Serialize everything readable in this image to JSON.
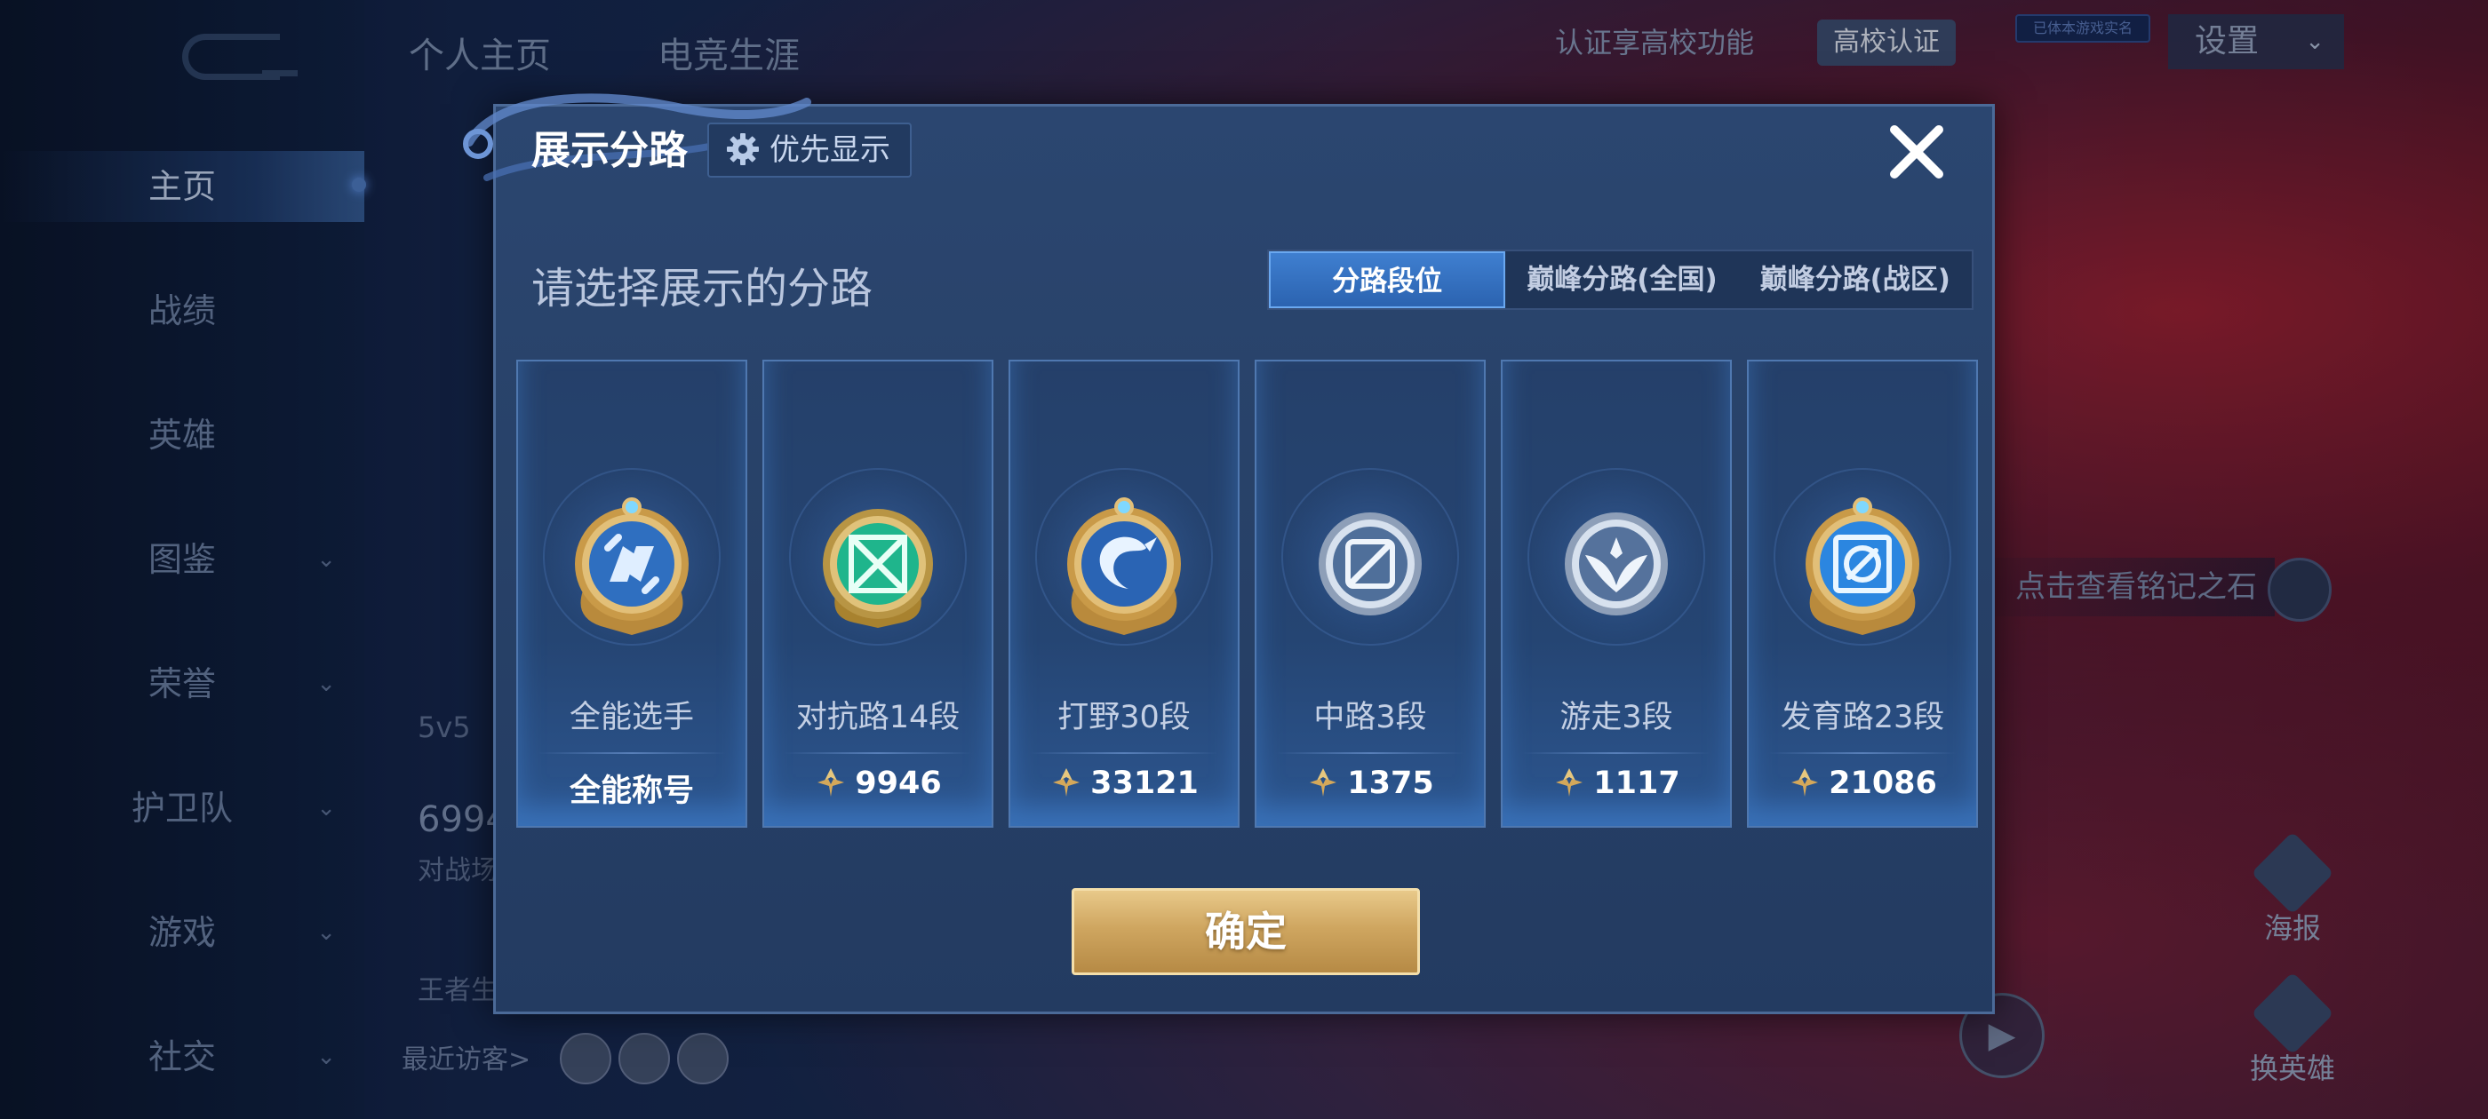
{
  "background": {
    "sidebar": {
      "items": [
        {
          "label": "主页",
          "active": true
        },
        {
          "label": "战绩"
        },
        {
          "label": "英雄"
        },
        {
          "label": "图鉴",
          "expandable": true
        },
        {
          "label": "荣誉",
          "expandable": true
        },
        {
          "label": "护卫队",
          "expandable": true
        },
        {
          "label": "游戏",
          "expandable": true
        },
        {
          "label": "社交",
          "expandable": true
        }
      ]
    },
    "top_tabs": [
      "个人主页",
      "电竞生涯"
    ],
    "cert_text": "认证享高校功能",
    "cert_badge": "高校认证",
    "tiny_tag": "已体本游戏实名",
    "settings": "设置",
    "stone_tip": "点击查看铭记之石",
    "poster": "海报",
    "swap_hero": "换英雄",
    "recent_visitors": "最近访客>",
    "partial": {
      "mode": "5v5",
      "count": "6994",
      "battle": "对战场",
      "king": "王者生"
    }
  },
  "modal": {
    "title": "展示分路",
    "priority_button": "优先显示",
    "subtitle": "请选择展示的分路",
    "tabs": [
      {
        "label": "分路段位",
        "active": true
      },
      {
        "label": "巅峰分路(全国)",
        "active": false
      },
      {
        "label": "巅峰分路(战区)",
        "active": false
      }
    ],
    "cards": [
      {
        "name": "全能选手",
        "score": "全能称号",
        "emblem": "allround-emblem",
        "score_icon": false
      },
      {
        "name": "对抗路14段",
        "score": "9946",
        "emblem": "clash-lane-emblem",
        "score_icon": true
      },
      {
        "name": "打野30段",
        "score": "33121",
        "emblem": "jungle-emblem",
        "score_icon": true
      },
      {
        "name": "中路3段",
        "score": "1375",
        "emblem": "mid-lane-emblem",
        "score_icon": true
      },
      {
        "name": "游走3段",
        "score": "1117",
        "emblem": "roam-emblem",
        "score_icon": true
      },
      {
        "name": "发育路23段",
        "score": "21086",
        "emblem": "farm-lane-emblem",
        "score_icon": true
      }
    ],
    "confirm": "确定"
  },
  "colors": {
    "gold": "#d4a85a",
    "accent_blue": "#3f7fd0",
    "modal_bg": "#284269"
  }
}
